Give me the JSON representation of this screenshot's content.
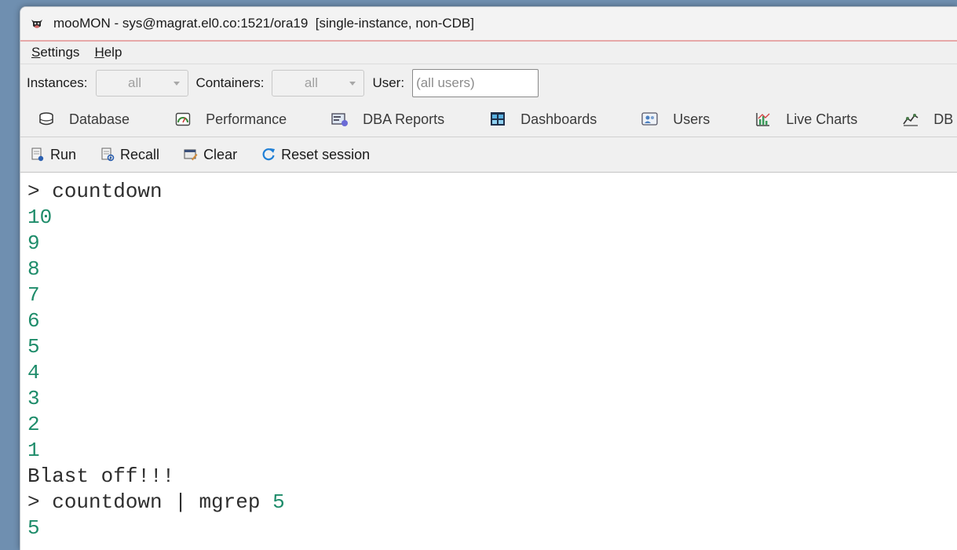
{
  "window": {
    "title": "mooMON - sys@magrat.el0.co:1521/ora19  [single-instance, non-CDB]",
    "icon": "cow-icon"
  },
  "menu": [
    {
      "label": "Settings",
      "mnemonic": "S",
      "rest": "ettings"
    },
    {
      "label": "Help",
      "mnemonic": "H",
      "rest": "elp"
    }
  ],
  "filters": {
    "instances_label": "Instances:",
    "instances_value": "all",
    "containers_label": "Containers:",
    "containers_value": "all",
    "user_label": "User:",
    "user_placeholder": "(all users)"
  },
  "tabs": [
    {
      "label": "Database",
      "icon": "database-icon"
    },
    {
      "label": "Performance",
      "icon": "performance-gauge-icon"
    },
    {
      "label": "DBA Reports",
      "icon": "dba-reports-icon"
    },
    {
      "label": "Dashboards",
      "icon": "dashboards-icon"
    },
    {
      "label": "Users",
      "icon": "users-icon"
    },
    {
      "label": "Live Charts",
      "icon": "live-charts-icon"
    },
    {
      "label": "DB Sessions",
      "icon": "db-sessions-icon"
    }
  ],
  "toolbar": {
    "run": "Run",
    "recall": "Recall",
    "clear": "Clear",
    "reset": "Reset session"
  },
  "console": {
    "prompt": ">",
    "cmd1": "countdown",
    "output1": [
      "10",
      "9",
      "8",
      "7",
      "6",
      "5",
      "4",
      "3",
      "2",
      "1"
    ],
    "blast": "Blast off!!!",
    "cmd2_text": "countdown | mgrep",
    "cmd2_arg": "5",
    "output2": [
      "5"
    ]
  },
  "colors": {
    "output": "#1e8c6a",
    "command": "#2e2e2e",
    "titlebar_accent": "#e6a8a8"
  }
}
